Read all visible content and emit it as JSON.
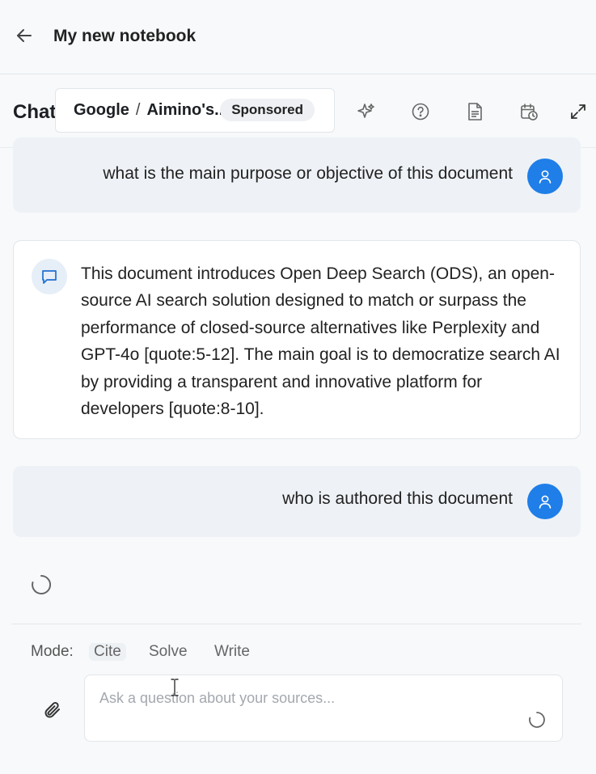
{
  "header": {
    "back_icon": "arrow-left-icon",
    "title": "My new notebook"
  },
  "chat_header": {
    "label": "Chat",
    "ad": {
      "brand": "Google",
      "separator": "/",
      "name": "Aimino's...",
      "badge": "Sponsored"
    },
    "tools": [
      "sparkle-icon",
      "help-circle-icon",
      "document-icon",
      "calendar-clock-icon",
      "expand-icon"
    ]
  },
  "messages": [
    {
      "role": "user",
      "text": "what is the main purpose or objective of this document"
    },
    {
      "role": "assistant",
      "text": "This document introduces Open Deep Search (ODS), an open-source AI search solution designed to match or surpass the performance of closed-source alternatives like Perplexity and GPT-4o [quote:5-12]. The main goal is to democratize search AI by providing a transparent and innovative platform for developers [quote:8-10]."
    },
    {
      "role": "user",
      "text": "who is authored this document"
    }
  ],
  "composer": {
    "mode_label": "Mode:",
    "modes": [
      "Cite",
      "Solve",
      "Write"
    ],
    "active_mode": "Cite",
    "placeholder": "Ask a question about your sources...",
    "value": ""
  },
  "colors": {
    "accent": "#1f7ee8",
    "user_bubble": "#eef2f6",
    "background": "#f7f9fb"
  }
}
